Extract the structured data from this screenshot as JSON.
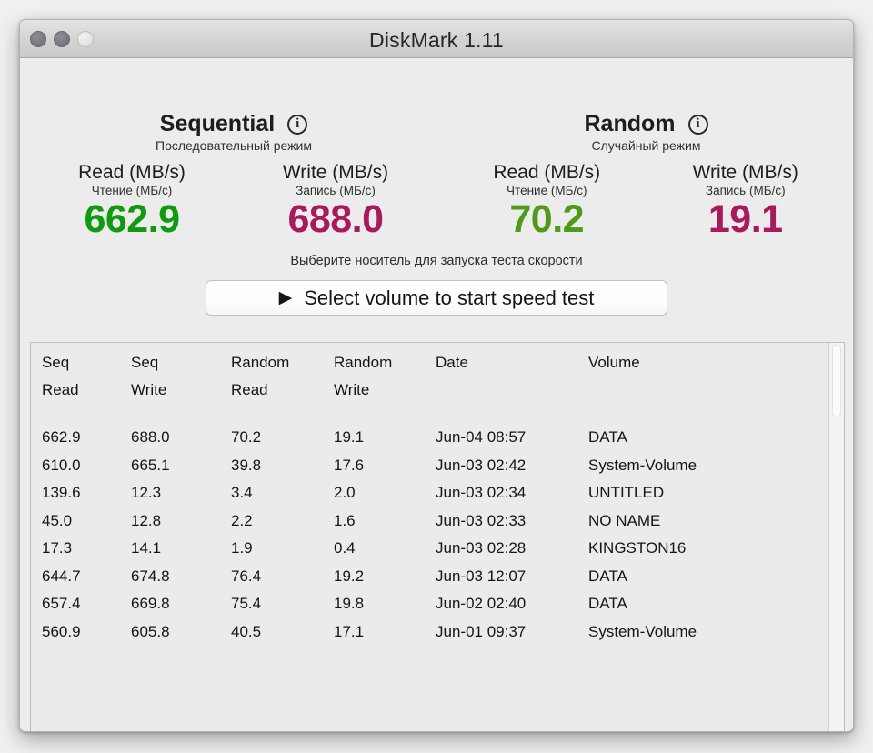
{
  "window": {
    "title": "DiskMark 1.11",
    "traffic_lights": [
      "close-button",
      "minimize-button",
      "zoom-button"
    ]
  },
  "stats": {
    "groups": [
      {
        "title": "Sequential",
        "subtitle": "Последовательный режим",
        "info_icon": "info-icon",
        "metrics": [
          {
            "label": "Read (MB/s)",
            "sublabel": "Чтение (МБ/с)",
            "value": "662.9",
            "color": "#0f9a10"
          },
          {
            "label": "Write (MB/s)",
            "sublabel": "Запись (МБ/с)",
            "value": "688.0",
            "color": "#a81a5e"
          }
        ]
      },
      {
        "title": "Random",
        "subtitle": "Случайный режим",
        "info_icon": "info-icon",
        "metrics": [
          {
            "label": "Read (MB/s)",
            "sublabel": "Чтение (МБ/с)",
            "value": "70.2",
            "color": "#4f9a16"
          },
          {
            "label": "Write (MB/s)",
            "sublabel": "Запись (МБ/с)",
            "value": "19.1",
            "color": "#a81a5e"
          }
        ]
      }
    ]
  },
  "action": {
    "hint": "Выберите носитель для запуска теста скорости",
    "play_glyph": "▶",
    "button_label": "Select volume to start speed test"
  },
  "table": {
    "headers_line1": [
      "Seq",
      "Seq",
      "Random",
      "Random",
      "Date",
      "Volume"
    ],
    "headers_line2": [
      "Read",
      "Write",
      "Read",
      "Write",
      "",
      ""
    ],
    "rows": [
      {
        "seq_read": "662.9",
        "seq_write": "688.0",
        "rnd_read": "70.2",
        "rnd_write": "19.1",
        "date": "Jun-04 08:57",
        "volume": "DATA"
      },
      {
        "seq_read": "610.0",
        "seq_write": "665.1",
        "rnd_read": "39.8",
        "rnd_write": "17.6",
        "date": "Jun-03 02:42",
        "volume": "System-Volume"
      },
      {
        "seq_read": "139.6",
        "seq_write": "12.3",
        "rnd_read": "3.4",
        "rnd_write": "2.0",
        "date": "Jun-03 02:34",
        "volume": "UNTITLED"
      },
      {
        "seq_read": "45.0",
        "seq_write": "12.8",
        "rnd_read": "2.2",
        "rnd_write": "1.6",
        "date": "Jun-03 02:33",
        "volume": "NO NAME"
      },
      {
        "seq_read": "17.3",
        "seq_write": "14.1",
        "rnd_read": "1.9",
        "rnd_write": "0.4",
        "date": "Jun-03 02:28",
        "volume": "KINGSTON16"
      },
      {
        "seq_read": "644.7",
        "seq_write": "674.8",
        "rnd_read": "76.4",
        "rnd_write": "19.2",
        "date": "Jun-03 12:07",
        "volume": "DATA"
      },
      {
        "seq_read": "657.4",
        "seq_write": "669.8",
        "rnd_read": "75.4",
        "rnd_write": "19.8",
        "date": "Jun-02 02:40",
        "volume": "DATA"
      },
      {
        "seq_read": "560.9",
        "seq_write": "605.8",
        "rnd_read": "40.5",
        "rnd_write": "17.1",
        "date": "Jun-01 09:37",
        "volume": "System-Volume"
      }
    ]
  }
}
